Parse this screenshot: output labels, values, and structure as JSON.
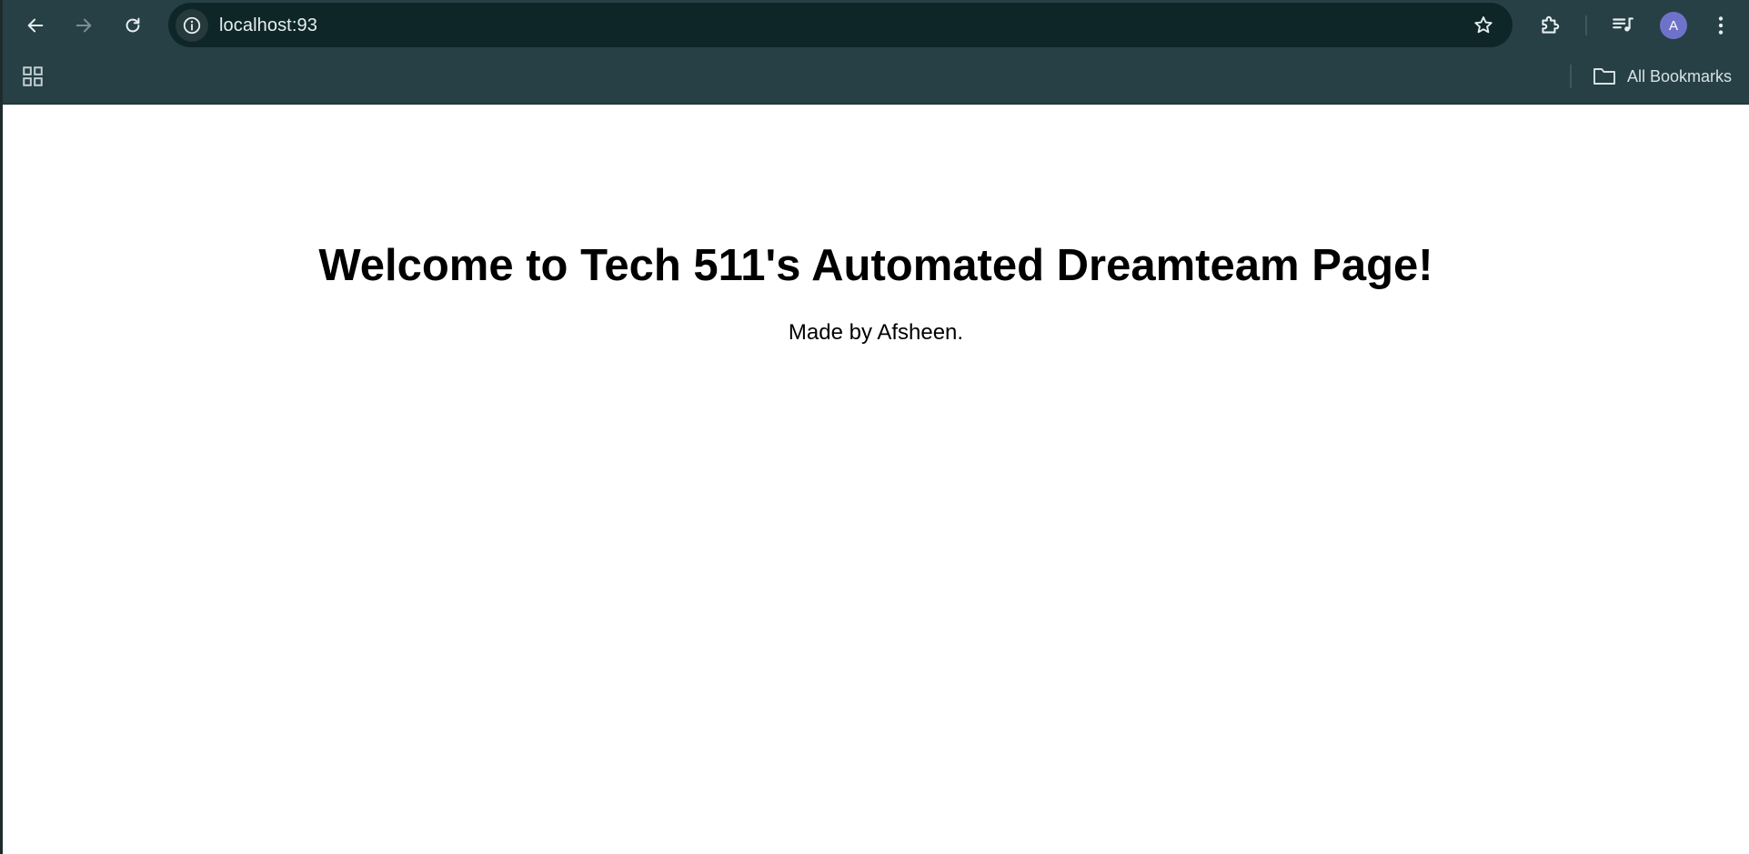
{
  "browser": {
    "url": "localhost:93",
    "profile_initial": "A",
    "bookmarks_label": "All Bookmarks",
    "icons": {
      "back": "arrow-left-icon",
      "forward": "arrow-right-icon",
      "reload": "reload-icon",
      "site_info": "info-icon",
      "bookmark_star": "star-icon",
      "extensions": "puzzle-icon",
      "media": "playlist-icon",
      "menu": "kebab-menu-icon",
      "apps": "apps-grid-icon",
      "folder": "folder-icon"
    },
    "colors": {
      "toolbar": "#264045",
      "omnibox": "#0f2629",
      "avatar": "#6f72c9"
    }
  },
  "page": {
    "headline": "Welcome to Tech 511's Automated Dreamteam Page!",
    "subtitle": "Made by Afsheen."
  }
}
